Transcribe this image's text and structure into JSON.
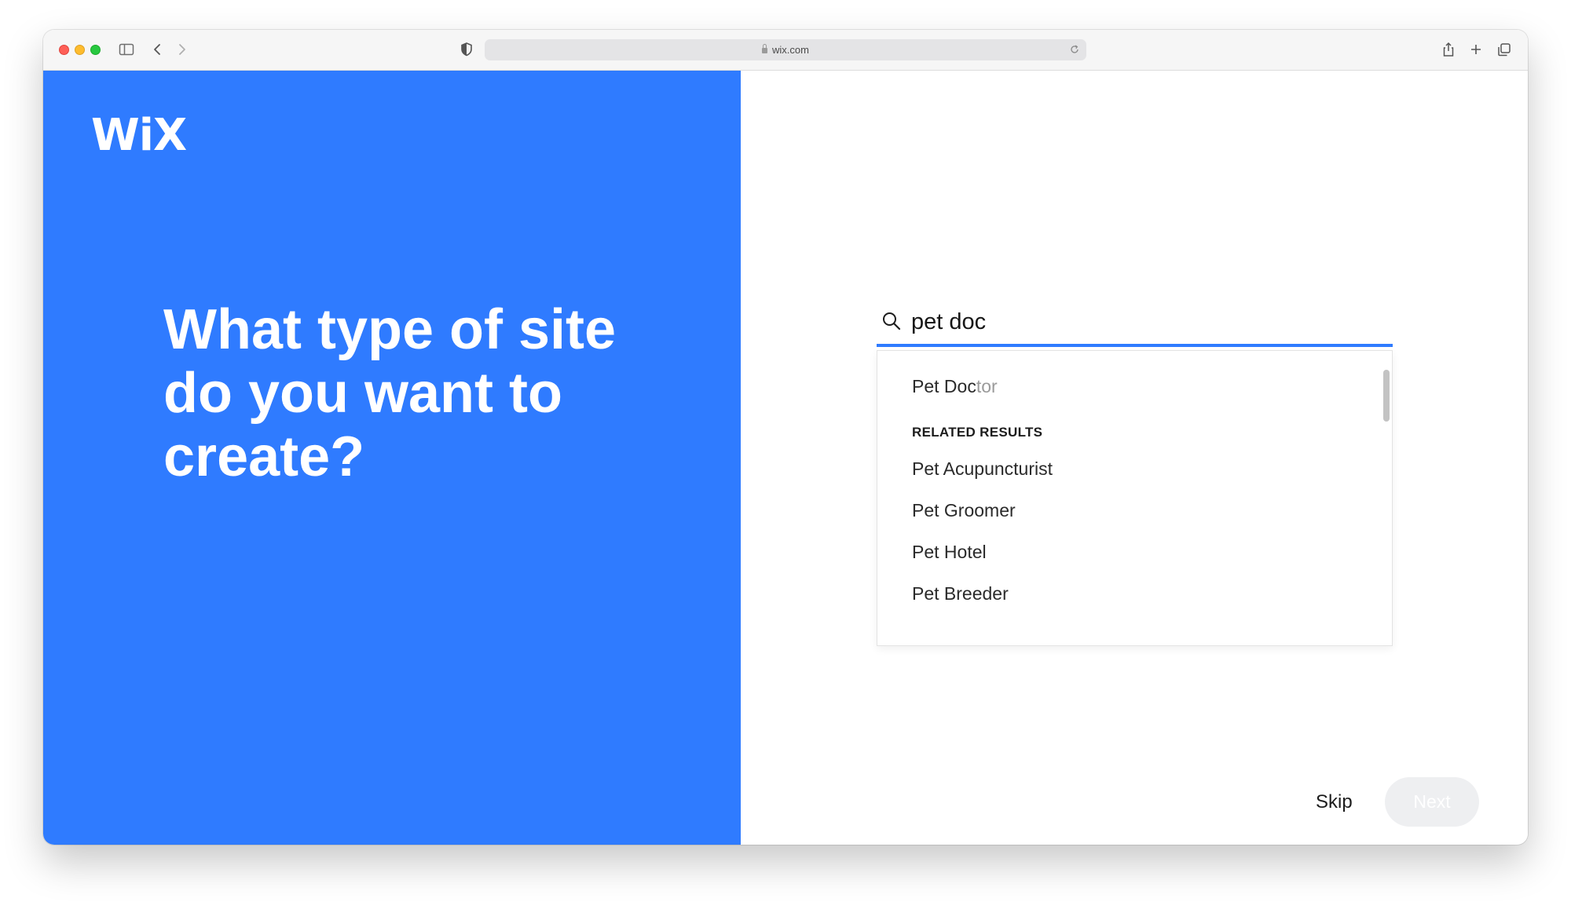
{
  "browser": {
    "url": "wix.com"
  },
  "brand": {
    "logo_text": "WiX",
    "accent_color": "#2f7bff"
  },
  "main": {
    "headline": "What type of site do you want to create?",
    "search": {
      "value": "pet doc",
      "icon": "search-icon"
    },
    "suggestion": {
      "typed": "Pet Doc",
      "completion": "tor"
    },
    "related_heading": "RELATED RESULTS",
    "related_results": [
      "Pet Acupuncturist",
      "Pet Groomer",
      "Pet Hotel",
      "Pet Breeder"
    ],
    "skip_label": "Skip",
    "next_label": "Next"
  }
}
